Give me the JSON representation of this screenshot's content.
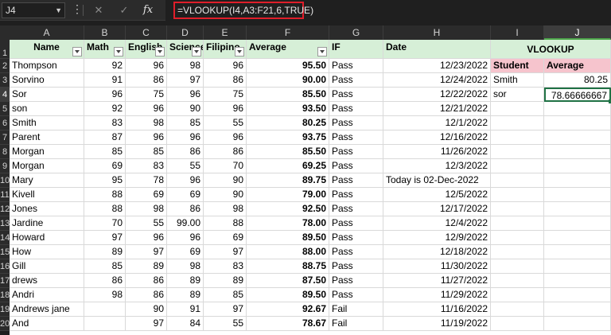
{
  "formula_bar": {
    "name_box": "J4",
    "cancel_icon": "✕",
    "enter_icon": "✓",
    "fx_label": "fx",
    "formula": "=VLOOKUP(I4,A3:F21,6,TRUE)"
  },
  "columns": [
    "A",
    "B",
    "C",
    "D",
    "E",
    "F",
    "G",
    "H",
    "I",
    "J"
  ],
  "selected_column": "J",
  "row_numbers": [
    "1",
    "2",
    "3",
    "4",
    "5",
    "6",
    "7",
    "8",
    "9",
    "10",
    "11",
    "12",
    "13",
    "14",
    "15",
    "16",
    "17",
    "18",
    "19",
    "20"
  ],
  "headers": {
    "name": "Name",
    "math": "Math",
    "english": "English",
    "science": "Science",
    "filipino": "Filipino",
    "average": "Average",
    "if": "IF",
    "date": "Date"
  },
  "rows": [
    {
      "name": "Thompson",
      "math": "92",
      "english": "96",
      "science": "98",
      "filipino": "96",
      "average": "95.50",
      "if": "Pass",
      "date": "12/23/2022"
    },
    {
      "name": "Sorvino",
      "math": "91",
      "english": "86",
      "science": "97",
      "filipino": "86",
      "average": "90.00",
      "if": "Pass",
      "date": "12/24/2022"
    },
    {
      "name": "Sor",
      "math": "96",
      "english": "75",
      "science": "96",
      "filipino": "75",
      "average": "85.50",
      "if": "Pass",
      "date": "12/22/2022"
    },
    {
      "name": "son",
      "math": "92",
      "english": "96",
      "science": "90",
      "filipino": "96",
      "average": "93.50",
      "if": "Pass",
      "date": "12/21/2022"
    },
    {
      "name": "Smith",
      "math": "83",
      "english": "98",
      "science": "85",
      "filipino": "55",
      "average": "80.25",
      "if": "Pass",
      "date": "12/1/2022"
    },
    {
      "name": "Parent",
      "math": "87",
      "english": "96",
      "science": "96",
      "filipino": "96",
      "average": "93.75",
      "if": "Pass",
      "date": "12/16/2022"
    },
    {
      "name": "Morgan",
      "math": "85",
      "english": "85",
      "science": "86",
      "filipino": "86",
      "average": "85.50",
      "if": "Pass",
      "date": "11/26/2022"
    },
    {
      "name": "Morgan",
      "math": "69",
      "english": "83",
      "science": "55",
      "filipino": "70",
      "average": "69.25",
      "if": "Pass",
      "date": "12/3/2022"
    },
    {
      "name": "Mary",
      "math": "95",
      "english": "78",
      "science": "96",
      "filipino": "90",
      "average": "89.75",
      "if": "Pass",
      "date": "Today is 02-Dec-2022"
    },
    {
      "name": "Kivell",
      "math": "88",
      "english": "69",
      "science": "69",
      "filipino": "90",
      "average": "79.00",
      "if": "Pass",
      "date": "12/5/2022"
    },
    {
      "name": "Jones",
      "math": "88",
      "english": "98",
      "science": "86",
      "filipino": "98",
      "average": "92.50",
      "if": "Pass",
      "date": "12/17/2022"
    },
    {
      "name": "Jardine",
      "math": "70",
      "english": "55",
      "science": "99.00",
      "filipino": "88",
      "average": "78.00",
      "if": "Pass",
      "date": "12/4/2022"
    },
    {
      "name": "Howard",
      "math": "97",
      "english": "96",
      "science": "96",
      "filipino": "69",
      "average": "89.50",
      "if": "Pass",
      "date": "12/9/2022"
    },
    {
      "name": "How",
      "math": "89",
      "english": "97",
      "science": "69",
      "filipino": "97",
      "average": "88.00",
      "if": "Pass",
      "date": "12/18/2022"
    },
    {
      "name": "Gill",
      "math": "85",
      "english": "89",
      "science": "98",
      "filipino": "83",
      "average": "88.75",
      "if": "Pass",
      "date": "11/30/2022"
    },
    {
      "name": "drews",
      "math": "86",
      "english": "86",
      "science": "89",
      "filipino": "89",
      "average": "87.50",
      "if": "Pass",
      "date": "11/27/2022"
    },
    {
      "name": "Andri",
      "math": "98",
      "english": "86",
      "science": "89",
      "filipino": "85",
      "average": "89.50",
      "if": "Pass",
      "date": "11/29/2022"
    },
    {
      "name": "Andrews jane",
      "math": "",
      "english": "90",
      "science": "91",
      "filipino": "97",
      "average": "92.67",
      "if": "Fail",
      "date": "11/16/2022"
    },
    {
      "name": "And",
      "math": "",
      "english": "97",
      "science": "84",
      "filipino": "55",
      "average": "78.67",
      "if": "Fail",
      "date": "11/19/2022"
    }
  ],
  "lookup": {
    "title": "VLOOKUP",
    "student_label": "Student",
    "average_label": "Average",
    "entries": [
      {
        "student": "Smith",
        "average": "80.25"
      },
      {
        "student": "sor",
        "average": "78.66666667"
      }
    ]
  }
}
